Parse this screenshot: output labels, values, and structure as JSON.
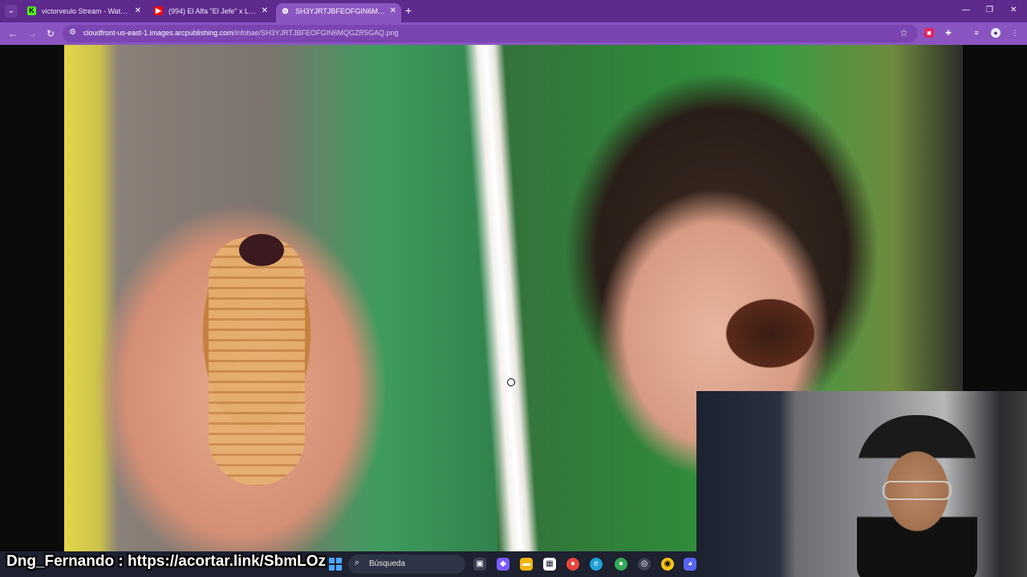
{
  "browser": {
    "tabs": [
      {
        "label": "victorveulo Stream - Watch Live",
        "favicon": "kick-icon",
        "color": "#53fc18"
      },
      {
        "label": "(994) El Alfa \"El Jefe\" x Lil Pump",
        "favicon": "youtube-icon",
        "color": "#ff0000"
      },
      {
        "label": "SH3YJRTJBFEOFGIN6MQGZR5",
        "favicon": "globe-icon",
        "color": "#ffffff"
      }
    ],
    "url_host": "cloudfront-us-east-1.images.arcpublishing.com",
    "url_path": "/infobae/SH3YJRTJBFEOFGIN6MQGZR5GAQ.png",
    "accent_color": "#8a55c0"
  },
  "overlay": {
    "caption": "Dng_Fernando : https://acortar.link/SbmLOz"
  },
  "taskbar": {
    "search_label": "Búsqueda"
  }
}
